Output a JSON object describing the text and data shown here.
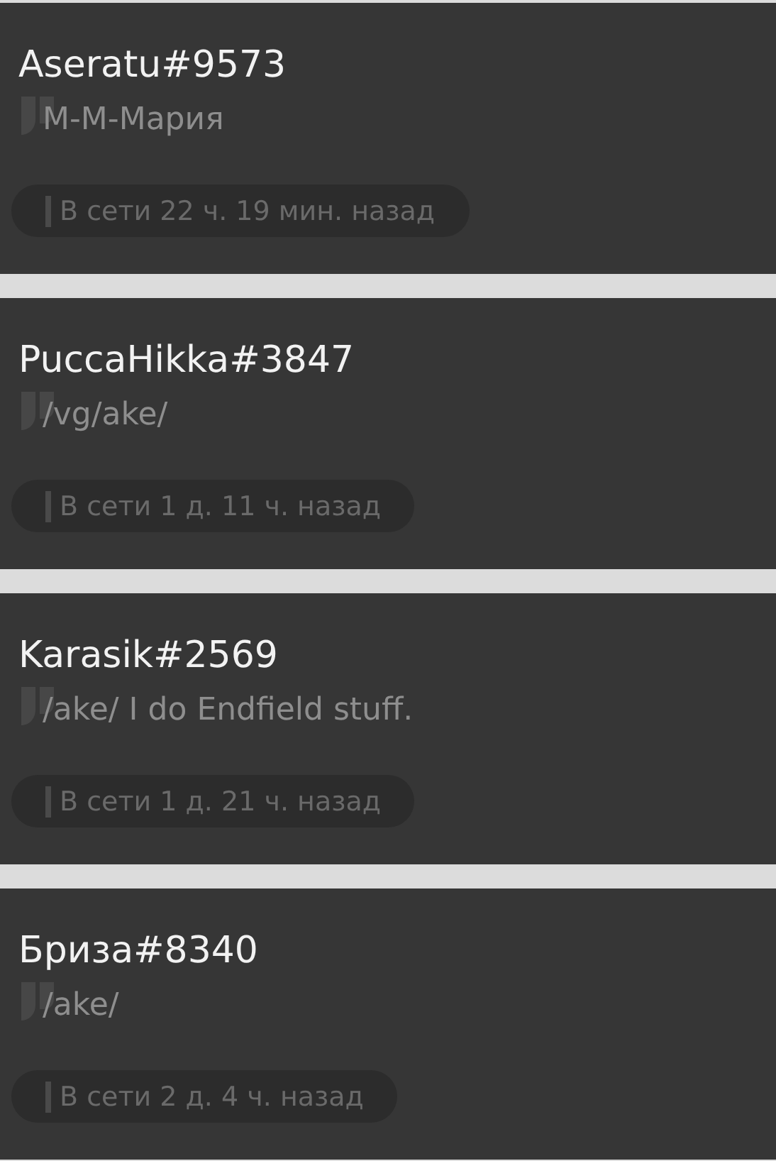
{
  "profiles": [
    {
      "name": "Aseratu#9573",
      "status_text": "М-М-Мария",
      "last_seen": "В сети 22 ч. 19 мин. назад"
    },
    {
      "name": "PuccaHikka#3847",
      "status_text": "/vg/ake/",
      "last_seen": "В сети 1 д. 11 ч. назад"
    },
    {
      "name": "Karasik#2569",
      "status_text": "/ake/ I do Endfield stuff.",
      "last_seen": "В сети 1 д. 21 ч. назад"
    },
    {
      "name": "Бриза#8340",
      "status_text": "/ake/",
      "last_seen": "В сети 2 д. 4 ч. назад"
    }
  ]
}
